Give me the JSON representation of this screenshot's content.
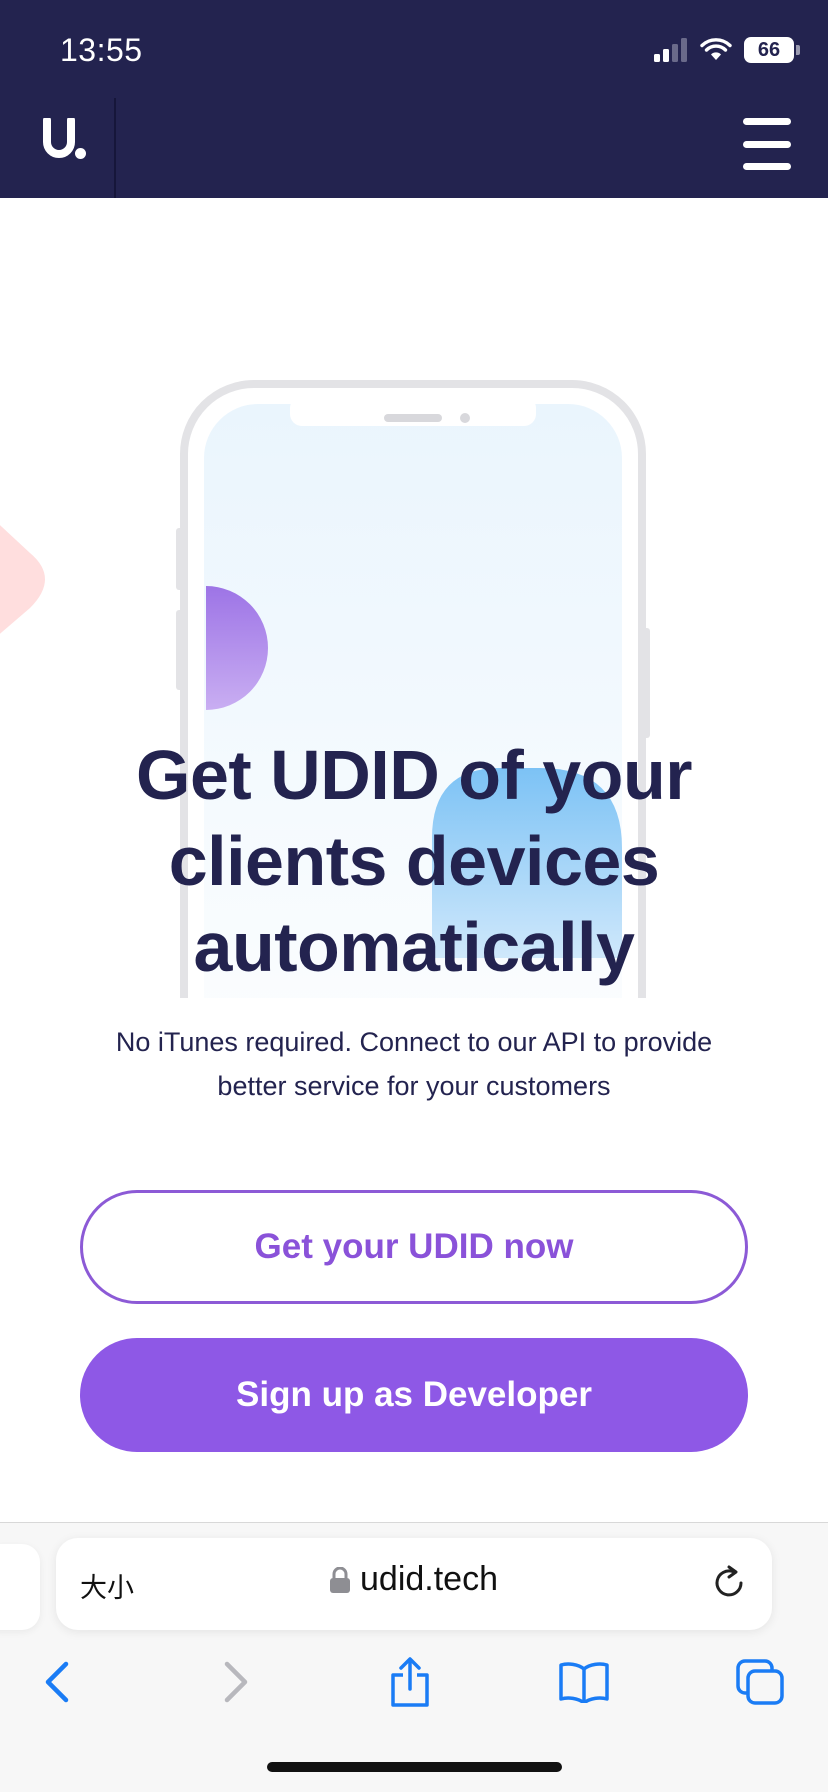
{
  "status_bar": {
    "time": "13:55",
    "battery": "66",
    "icons": [
      "cellular-signal-icon",
      "wifi-icon",
      "battery-icon"
    ]
  },
  "header": {
    "logo": "u.",
    "menu_icon": "hamburger-icon",
    "background_color": "#23234f"
  },
  "hero": {
    "title": "Get UDID of your clients devices automatically",
    "subtitle": "No iTunes required. Connect to our API to provide better service for your customers"
  },
  "actions": {
    "primary_label": "Get your UDID now",
    "secondary_label": "Sign up as Developer",
    "accent_color": "#8e58e6"
  },
  "browser": {
    "text_size_label": "大小",
    "url": "udid.tech",
    "icons": [
      "lock-icon",
      "reload-icon",
      "back-icon",
      "forward-icon",
      "share-icon",
      "bookmarks-icon",
      "tabs-icon"
    ]
  }
}
